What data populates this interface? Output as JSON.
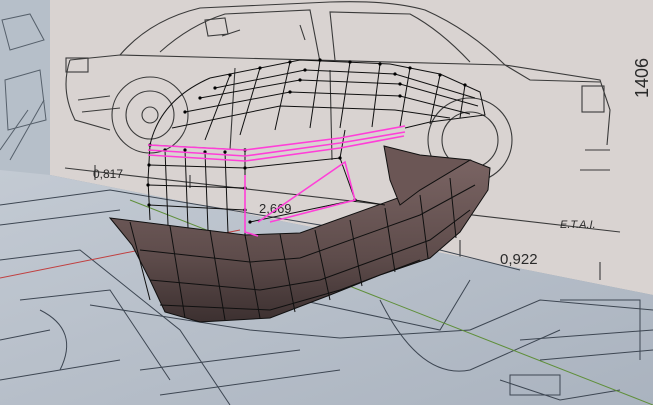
{
  "viewport": {
    "colors": {
      "background": "#9aa3ac",
      "blueprint_paper": "#d9d3d1",
      "floor_blueprint": "#b7c0cb",
      "mesh_surface": "#5e4c4b",
      "mesh_wire": "#101010",
      "selected_edge": "#ff3fd8",
      "axis_x": "#c04040",
      "axis_y": "#5f8f3a"
    }
  },
  "blueprint": {
    "dimension_side_length": "0,817",
    "dimension_wheelbase": "2,669",
    "dimension_rear_overhang": "0,922",
    "dimension_height": "1406",
    "maker_label": "E.T.A.I."
  }
}
